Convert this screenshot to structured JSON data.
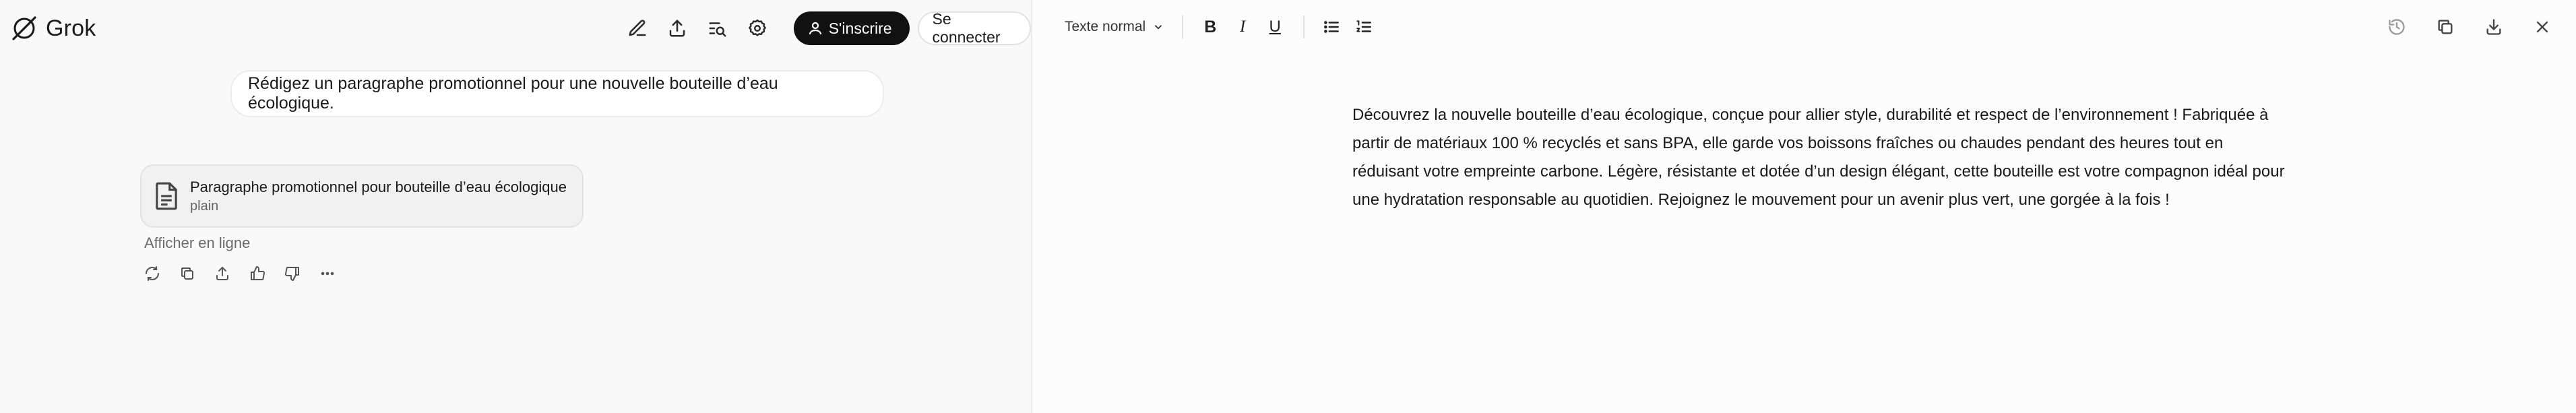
{
  "app": {
    "name": "Grok"
  },
  "header": {
    "signup_label": "S'inscrire",
    "login_label": "Se connecter",
    "icons": [
      "edit-icon",
      "share-icon",
      "search-icon",
      "settings-icon"
    ]
  },
  "chat": {
    "user_message": "Rédigez un paragraphe promotionnel pour une nouvelle bouteille d’eau écologique.",
    "artifact": {
      "title": "Paragraphe promotionnel pour bouteille d’eau écologique",
      "subtitle": "plain"
    },
    "inline_link": "Afficher en ligne",
    "actions": [
      "regenerate-icon",
      "copy-icon",
      "share-icon",
      "thumbs-up-icon",
      "thumbs-down-icon",
      "more-icon"
    ]
  },
  "editor": {
    "style_select": "Texte normal",
    "format": {
      "bold": "B",
      "italic": "I",
      "underline": "U"
    },
    "document_text": "Découvrez la nouvelle bouteille d’eau écologique, conçue pour allier style, durabilité et respect de l’environnement ! Fabriquée à partir de matériaux 100 % recyclés et sans BPA, elle garde vos boissons fraîches ou chaudes pendant des heures tout en réduisant votre empreinte carbone. Légère, résistante et dotée d’un design élégant, cette bouteille est votre compagnon idéal pour une hydratation responsable au quotidien. Rejoignez le mouvement pour un avenir plus vert, une gorgée à la fois !"
  }
}
